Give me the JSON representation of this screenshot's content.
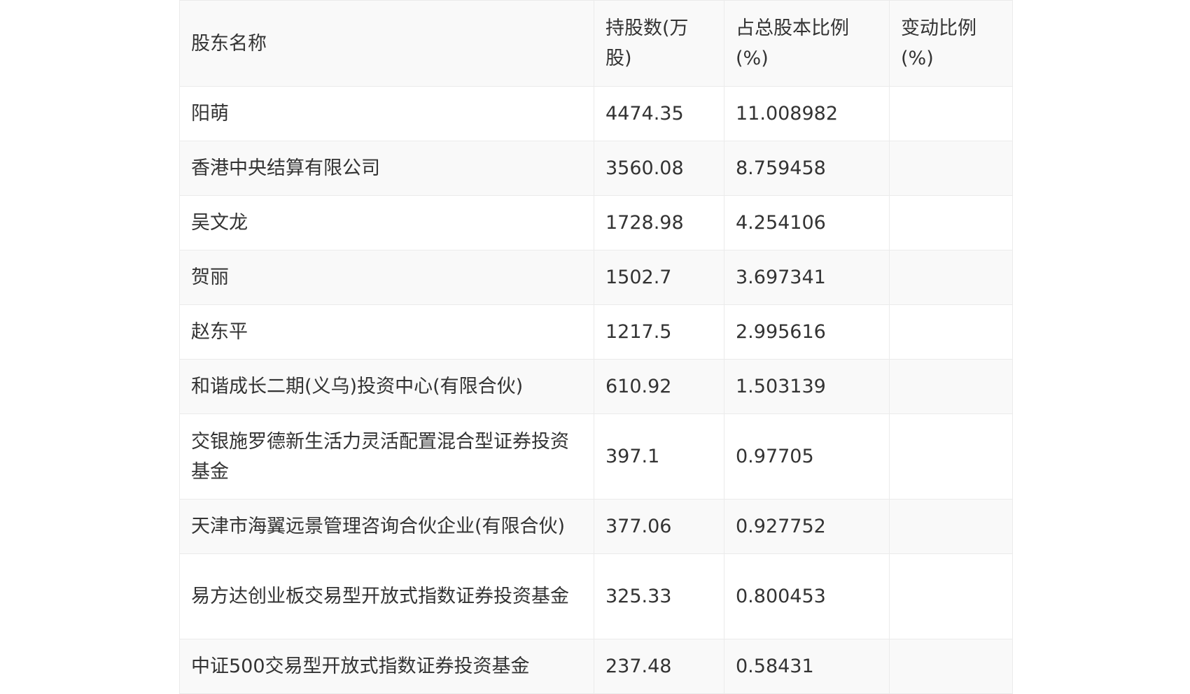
{
  "table": {
    "headers": [
      "股东名称",
      "持股数(万股)",
      "占总股本比例(%)",
      "变动比例(%)"
    ],
    "rows": [
      {
        "name": "阳萌",
        "shares": "4474.35",
        "ratio": "11.008982",
        "change": ""
      },
      {
        "name": "香港中央结算有限公司",
        "shares": "3560.08",
        "ratio": "8.759458",
        "change": ""
      },
      {
        "name": "吴文龙",
        "shares": "1728.98",
        "ratio": "4.254106",
        "change": ""
      },
      {
        "name": "贺丽",
        "shares": "1502.7",
        "ratio": "3.697341",
        "change": ""
      },
      {
        "name": "赵东平",
        "shares": "1217.5",
        "ratio": "2.995616",
        "change": ""
      },
      {
        "name": "和谐成长二期(义乌)投资中心(有限合伙)",
        "shares": "610.92",
        "ratio": "1.503139",
        "change": ""
      },
      {
        "name": "交银施罗德新生活力灵活配置混合型证券投资基金",
        "shares": "397.1",
        "ratio": "0.97705",
        "change": ""
      },
      {
        "name": "天津市海翼远景管理咨询合伙企业(有限合伙)",
        "shares": "377.06",
        "ratio": "0.927752",
        "change": ""
      },
      {
        "name": "易方达创业板交易型开放式指数证券投资基金",
        "shares": "325.33",
        "ratio": "0.800453",
        "change": ""
      },
      {
        "name": "中证500交易型开放式指数证券投资基金",
        "shares": "237.48",
        "ratio": "0.58431",
        "change": ""
      }
    ]
  }
}
